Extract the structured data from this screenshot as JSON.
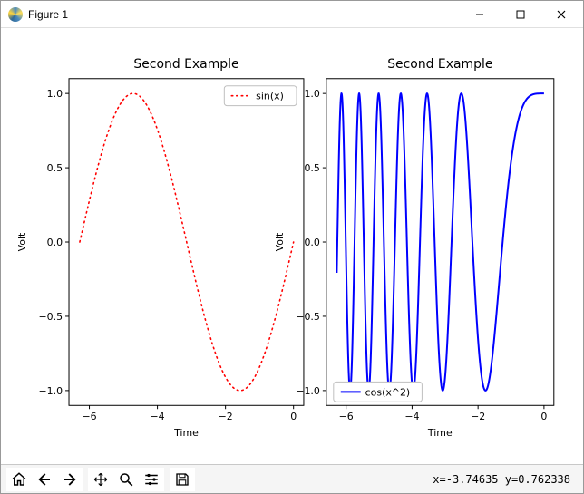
{
  "window": {
    "title": "Figure 1"
  },
  "toolbar": {
    "coord_text": "x=-3.74635     y=0.762338"
  },
  "left": {
    "title": "Second Example",
    "xlabel": "Time",
    "ylabel": "Volt",
    "legend": "sin(x)",
    "xticks": [
      "−6",
      "−4",
      "−2",
      "0"
    ],
    "yticks": [
      "−1.0",
      "−0.5",
      "0.0",
      "0.5",
      "1.0"
    ]
  },
  "right": {
    "title": "Second Example",
    "xlabel": "Time",
    "ylabel": "Volt",
    "legend": "cos(x^2)",
    "xticks": [
      "−6",
      "−4",
      "−2",
      "0"
    ],
    "yticks": [
      "−1.0",
      "−0.5",
      "0.0",
      "0.5",
      "1.0"
    ]
  },
  "chart_data": [
    {
      "type": "line",
      "title": "Second Example",
      "xlabel": "Time",
      "ylabel": "Volt",
      "xlim": [
        -6.6,
        0.3
      ],
      "ylim": [
        -1.1,
        1.1
      ],
      "x_ticks": [
        -6,
        -4,
        -2,
        0
      ],
      "y_ticks": [
        -1.0,
        -0.5,
        0.0,
        0.5,
        1.0
      ],
      "series": [
        {
          "name": "sin(x)",
          "color": "#ff0000",
          "style": "dotted",
          "x_range": [
            -6.2832,
            0
          ],
          "function": "sin(x)",
          "sample_points": [
            [
              -6.2832,
              0.0
            ],
            [
              -5.4978,
              0.7071
            ],
            [
              -4.7124,
              1.0
            ],
            [
              -3.927,
              0.7071
            ],
            [
              -3.1416,
              0.0
            ],
            [
              -2.3562,
              -0.7071
            ],
            [
              -1.5708,
              -1.0
            ],
            [
              -0.7854,
              -0.7071
            ],
            [
              0.0,
              0.0
            ]
          ]
        }
      ],
      "legend_position": "upper right"
    },
    {
      "type": "line",
      "title": "Second Example",
      "xlabel": "Time",
      "ylabel": "Volt",
      "xlim": [
        -6.6,
        0.3
      ],
      "ylim": [
        -1.1,
        1.1
      ],
      "x_ticks": [
        -6,
        -4,
        -2,
        0
      ],
      "y_ticks": [
        -1.0,
        -0.5,
        0.0,
        0.5,
        1.0
      ],
      "series": [
        {
          "name": "cos(x^2)",
          "color": "#0000ff",
          "style": "solid",
          "x_range": [
            -6.2832,
            0
          ],
          "function": "cos(x*x)",
          "approx_zero_crossings": [
            -6.24,
            -6.0,
            -5.73,
            -5.46,
            -5.17,
            -4.86,
            -4.53,
            -4.16,
            -3.76,
            -3.32,
            -2.8,
            -2.17,
            -1.25
          ],
          "endpoints": [
            [
              -6.2832,
              -0.22
            ],
            [
              0.0,
              1.0
            ]
          ]
        }
      ],
      "legend_position": "lower left"
    }
  ]
}
